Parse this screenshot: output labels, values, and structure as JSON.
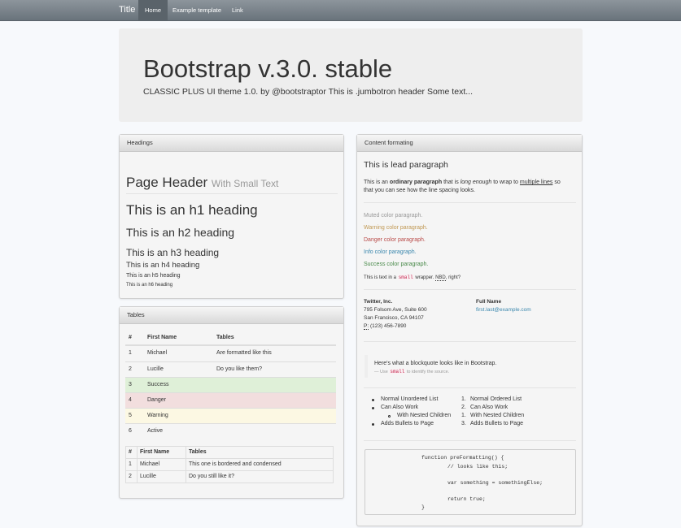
{
  "navbar": {
    "brand": "Title",
    "links": [
      "Home",
      "Example template",
      "Link"
    ]
  },
  "jumbotron": {
    "title": "Bootstrap v.3.0. stable",
    "text": "CLASSIC PLUS UI theme 1.0. by @bootstraptor This is .jumbotron header Some text..."
  },
  "headings_panel": {
    "title": "Headings",
    "page_header": "Page Header",
    "page_header_small": "With Small Text",
    "h1": "This is an h1 heading",
    "h2": "This is an h2 heading",
    "h3": "This is an h3 heading",
    "h4": "This is an h4 heading",
    "h5": "This is an h5 heading",
    "h6": "This is an h6 heading"
  },
  "tables_panel": {
    "title": "Tables",
    "table1": {
      "headers": [
        "#",
        "First Name",
        "Tables"
      ],
      "rows": [
        [
          "1",
          "Michael",
          "Are formatted like this"
        ],
        [
          "2",
          "Lucille",
          "Do you like them?"
        ],
        [
          "3",
          "Success",
          ""
        ],
        [
          "4",
          "Danger",
          ""
        ],
        [
          "5",
          "Warning",
          ""
        ],
        [
          "6",
          "Active",
          ""
        ]
      ]
    },
    "table2": {
      "headers": [
        "#",
        "First Name",
        "Tables"
      ],
      "rows": [
        [
          "1",
          "Michael",
          "This one is bordered and condensed"
        ],
        [
          "2",
          "Lucille",
          "Do you still like it?"
        ]
      ]
    }
  },
  "content_panel": {
    "title": "Content formating",
    "lead": "This is lead paragraph",
    "para_1": "This is an",
    "para_strong": "ordinary paragraph",
    "para_2": "that is",
    "para_em": "long enough",
    "para_3": "to wrap to",
    "para_u": "multiple lines",
    "para_4": "so",
    "para_line2": "that you can see how the line spacing looks.",
    "muted": "Muted color paragraph.",
    "warning": "Warning color paragraph.",
    "danger": "Danger color paragraph.",
    "info": "Info color paragraph.",
    "success": "Success color paragraph.",
    "small_1": "This is text in a",
    "small_code": "small",
    "small_2": "wrapper.",
    "small_abbr": "NBD",
    "small_3": ", right?",
    "address": {
      "company": "Twitter, Inc.",
      "street": "795 Folsom Ave, Suite 600",
      "city": "San Francisco, CA 94107",
      "phone_abbr": "P:",
      "phone": "(123) 456-7890",
      "name": "Full Name",
      "email": "first.last@example.com"
    },
    "blockquote": {
      "text": "Here's what a blockquote looks like in Bootstrap.",
      "source_1": "— Use",
      "source_code": "small",
      "source_2": "to identify the source."
    },
    "unordered": [
      "Normal Unordered List",
      "Can Also Work",
      "With Nested Children",
      "Adds Bullets to Page"
    ],
    "ordered": [
      "Normal Ordered List",
      "Can Also Work",
      "With Nested Children",
      "Adds Bullets to Page"
    ],
    "ordered_nums": [
      "1.",
      "2.",
      "1.",
      "3."
    ],
    "code": [
      "function preFormatting() {",
      "// looks like this;",
      "var something = somethingElse;",
      "return true;",
      "}"
    ]
  }
}
